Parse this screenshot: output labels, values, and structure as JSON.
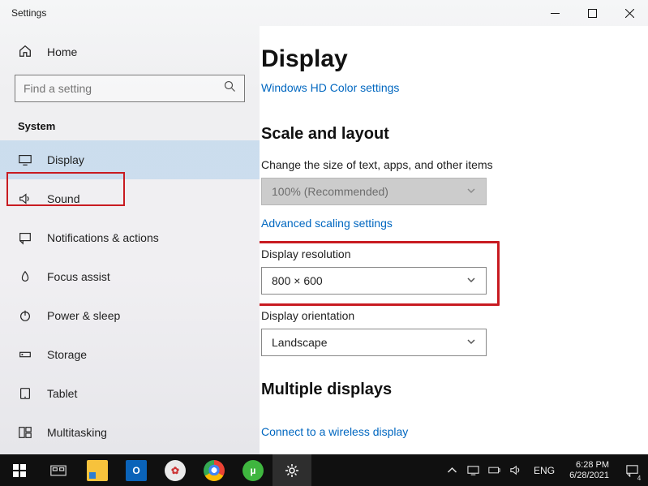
{
  "window": {
    "title": "Settings"
  },
  "sidebar": {
    "home_label": "Home",
    "search_placeholder": "Find a setting",
    "section_label": "System",
    "items": [
      {
        "label": "Display",
        "icon": "display",
        "selected": true
      },
      {
        "label": "Sound",
        "icon": "sound"
      },
      {
        "label": "Notifications & actions",
        "icon": "notifications"
      },
      {
        "label": "Focus assist",
        "icon": "focus"
      },
      {
        "label": "Power & sleep",
        "icon": "power"
      },
      {
        "label": "Storage",
        "icon": "storage"
      },
      {
        "label": "Tablet",
        "icon": "tablet"
      },
      {
        "label": "Multitasking",
        "icon": "multitasking"
      }
    ]
  },
  "main": {
    "page_title": "Display",
    "hd_color_link": "Windows HD Color settings",
    "scale_heading": "Scale and layout",
    "scale_label": "Change the size of text, apps, and other items",
    "scale_value": "100% (Recommended)",
    "advanced_scaling_link": "Advanced scaling settings",
    "resolution_label": "Display resolution",
    "resolution_value": "800 × 600",
    "orientation_label": "Display orientation",
    "orientation_value": "Landscape",
    "multi_heading": "Multiple displays",
    "wireless_link": "Connect to a wireless display"
  },
  "taskbar": {
    "lang": "ENG",
    "time": "6:28 PM",
    "date": "6/28/2021",
    "notif_count": "4"
  }
}
